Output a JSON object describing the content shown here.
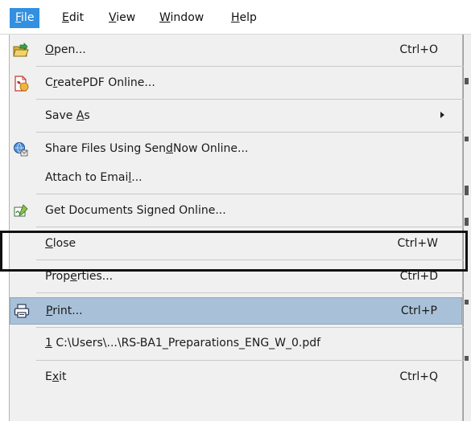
{
  "menubar": {
    "items": [
      {
        "label": "File",
        "mnemonic": "F",
        "rest": "ile",
        "active": true
      },
      {
        "label": "Edit",
        "mnemonic": "E",
        "rest": "dit"
      },
      {
        "label": "View",
        "mnemonic": "V",
        "rest": "iew"
      },
      {
        "label": "Window",
        "mnemonic": "W",
        "rest": "indow"
      },
      {
        "label": "Help",
        "mnemonic": "H",
        "rest": "elp"
      }
    ]
  },
  "file_menu": {
    "items": [
      {
        "label": "Open...",
        "pre": "",
        "mn": "O",
        "post": "pen...",
        "shortcut": "Ctrl+O",
        "icon": "open-folder-icon"
      },
      {
        "label": "CreatePDF Online...",
        "pre": "C",
        "mn": "r",
        "post": "eatePDF Online...",
        "shortcut": "",
        "icon": "create-pdf-icon"
      },
      {
        "label": "Save As",
        "pre": "Save ",
        "mn": "A",
        "post": "s",
        "shortcut": "",
        "submenu": true
      },
      {
        "label": "Share Files Using SendNow Online...",
        "pre": "Share Files Using Sen",
        "mn": "d",
        "post": "Now Online...",
        "shortcut": "",
        "icon": "share-globe-icon"
      },
      {
        "label": "Attach to Email...",
        "pre": "Attach to Emai",
        "mn": "l",
        "post": "...",
        "shortcut": ""
      },
      {
        "label": "Get Documents Signed Online...",
        "pre": "Get Documents Signed Online...",
        "mn": "",
        "post": "",
        "shortcut": "",
        "icon": "sign-pen-icon"
      },
      {
        "label": "Close",
        "pre": "",
        "mn": "C",
        "post": "lose",
        "shortcut": "Ctrl+W"
      },
      {
        "label": "Properties...",
        "pre": "Prop",
        "mn": "e",
        "post": "rties...",
        "shortcut": "Ctrl+D"
      },
      {
        "label": "Print...",
        "pre": "",
        "mn": "P",
        "post": "rint...",
        "shortcut": "Ctrl+P",
        "icon": "printer-icon",
        "highlighted": true
      },
      {
        "label": "1 C:\\Users\\...\\RS-BA1_Preparations_ENG_W_0.pdf",
        "pre": "",
        "mn": "1",
        "post": " C:\\Users\\...\\RS-BA1_Preparations_ENG_W_0.pdf",
        "shortcut": ""
      },
      {
        "label": "Exit",
        "pre": "E",
        "mn": "x",
        "post": "it",
        "shortcut": "Ctrl+Q"
      }
    ]
  },
  "colors": {
    "menubar_active": "#3390e0",
    "menu_background": "#f0f0f0",
    "highlight_fill": "#a9c1d8",
    "callout_border": "#111111"
  }
}
